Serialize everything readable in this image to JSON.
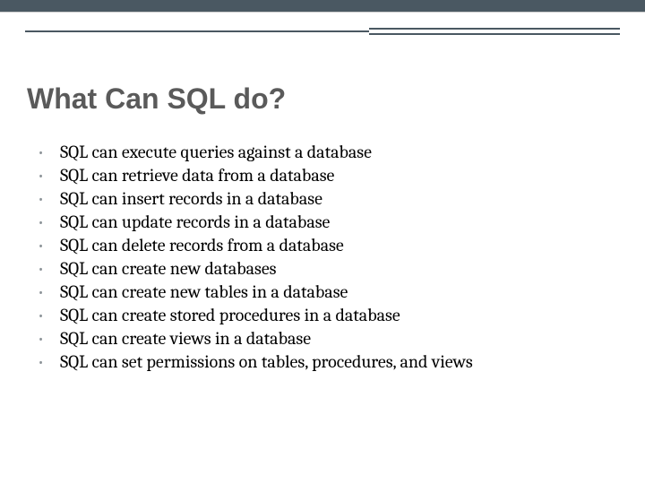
{
  "title": "What Can SQL do?",
  "bullets": [
    "SQL can execute queries against a database",
    "SQL can retrieve data from a database",
    "SQL can insert records in a database",
    "SQL can update records in a database",
    "SQL can delete records from a database",
    "SQL can create  new databases",
    "SQL can create new tables in a database",
    "SQL can create stored procedures in a database",
    "SQL can create views in a database",
    "SQL can set permissions on tables, procedures, and views"
  ]
}
